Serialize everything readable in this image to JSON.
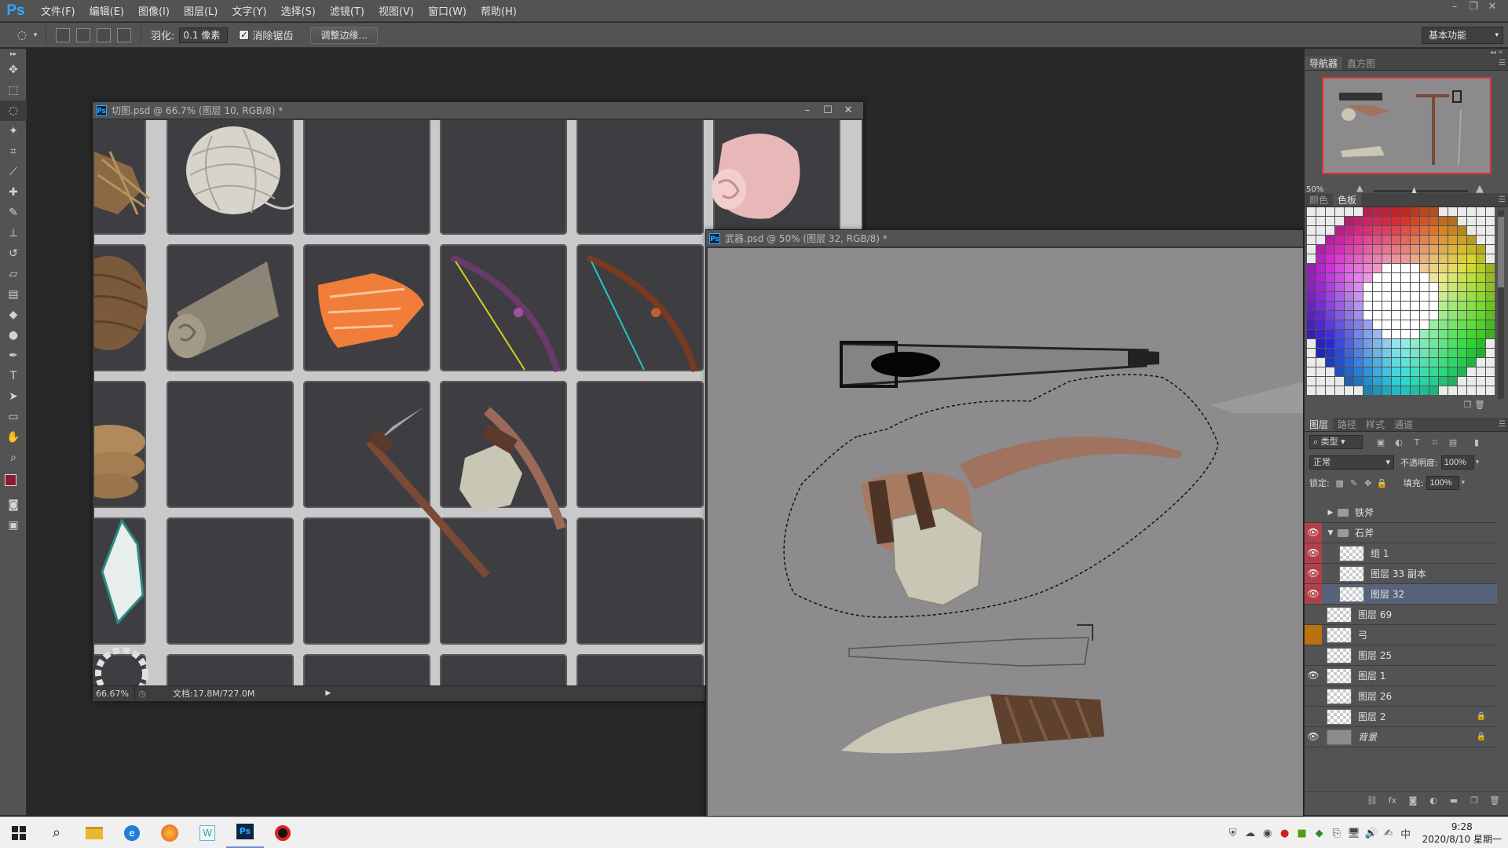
{
  "app": {
    "logo": "Ps",
    "menu": [
      "文件(F)",
      "编辑(E)",
      "图像(I)",
      "图层(L)",
      "文字(Y)",
      "选择(S)",
      "滤镜(T)",
      "视图(V)",
      "窗口(W)",
      "帮助(H)"
    ]
  },
  "options": {
    "feather_label": "羽化:",
    "feather_value": "0.1 像素",
    "antialias_label": "消除锯齿",
    "antialias_checked": true,
    "refine_edge": "调整边缘...",
    "workspace": "基本功能"
  },
  "doc1": {
    "title": "切图.psd @ 66.7% (图层 10, RGB/8) *",
    "zoom": "66.67%",
    "doc_size": "文档:17.8M/727.0M"
  },
  "doc2": {
    "title": "武器.psd @ 50% (图层 32, RGB/8) *"
  },
  "navigator": {
    "tabs": [
      "导航器",
      "直方图"
    ],
    "zoom": "50%"
  },
  "swatches": {
    "tabs": [
      "颜色",
      "色板"
    ]
  },
  "layers": {
    "tabs": [
      "图层",
      "路径",
      "样式",
      "通道"
    ],
    "filter": "类型",
    "blend_mode": "正常",
    "opacity_label": "不透明度:",
    "opacity": "100%",
    "lock_label": "锁定:",
    "fill_label": "填充:",
    "fill": "100%",
    "items": [
      {
        "name": "铁斧",
        "type": "group",
        "expanded": false,
        "visible": false,
        "indent": 0
      },
      {
        "name": "石斧",
        "type": "group",
        "expanded": true,
        "visible": true,
        "indent": 0
      },
      {
        "name": "组 1",
        "type": "layer",
        "visible": true,
        "indent": 1
      },
      {
        "name": "图层 33 副本",
        "type": "layer",
        "visible": true,
        "indent": 1
      },
      {
        "name": "图层 32",
        "type": "layer",
        "visible": true,
        "indent": 1,
        "selected": true
      },
      {
        "name": "图层 69",
        "type": "layer",
        "visible": false,
        "indent": 0
      },
      {
        "name": "弓",
        "type": "layer",
        "visible": false,
        "indent": 0,
        "color": "orange"
      },
      {
        "name": "图层 25",
        "type": "layer",
        "visible": false,
        "indent": 0
      },
      {
        "name": "图层 1",
        "type": "layer",
        "visible": true,
        "indent": 0
      },
      {
        "name": "图层 26",
        "type": "layer",
        "visible": false,
        "indent": 0
      },
      {
        "name": "图层 2",
        "type": "layer",
        "visible": false,
        "indent": 0,
        "locked": true
      },
      {
        "name": "背景",
        "type": "background",
        "visible": true,
        "indent": 0,
        "locked": true
      }
    ]
  },
  "taskbar": {
    "time": "9:28",
    "date": "2020/8/10 星期一"
  },
  "colors": {
    "foreground": "#8a1a34",
    "background": "#ffffff",
    "selection_red": "#b2404a"
  }
}
